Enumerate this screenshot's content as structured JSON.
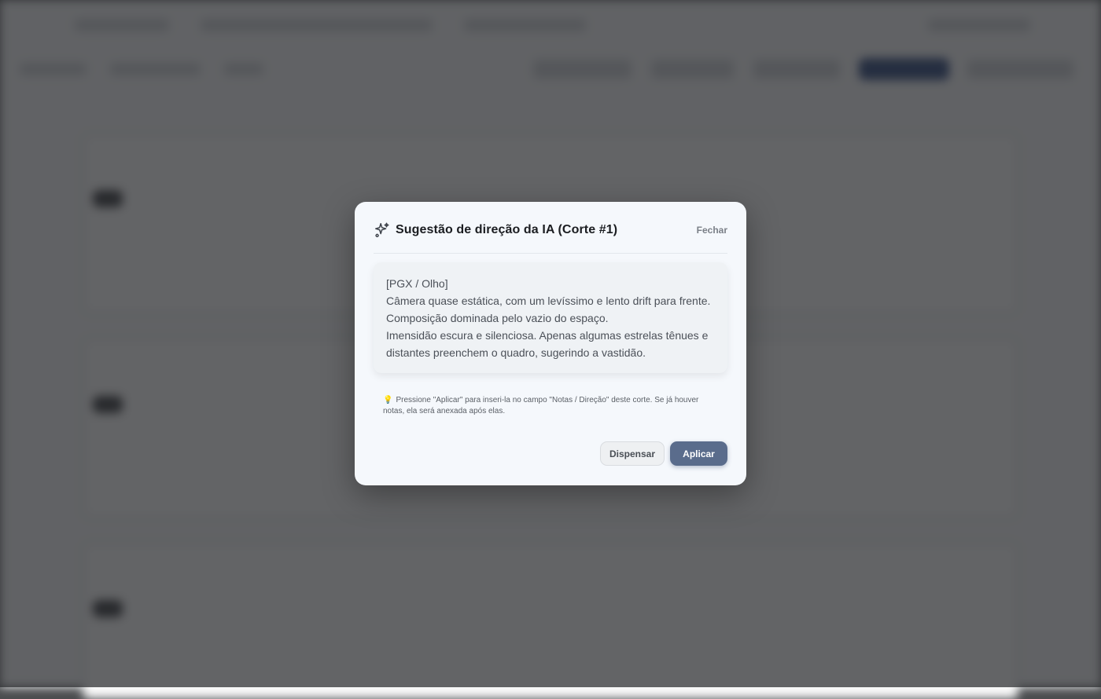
{
  "modal": {
    "title": "Sugestão de direção da IA (Corte #1)",
    "title_icon": "sparkle-icon",
    "close_label": "Fechar",
    "suggestion_lines": [
      "[PGX / Olho]",
      "Câmera quase estática, com um levíssimo e lento drift para frente.",
      "Composição dominada pelo vazio do espaço.",
      "Imensidão escura e silenciosa. Apenas algumas estrelas tênues e distantes preenchem o quadro, sugerindo a vastidão."
    ],
    "hint_icon": "lightbulb-icon",
    "hint_text": "Pressione \"Aplicar\" para inseri-la no campo \"Notas / Direção\" deste corte. Se já houver notas, ela será anexada após elas.",
    "dismiss_label": "Dispensar",
    "apply_label": "Aplicar"
  },
  "colors": {
    "apply_button": "#5a6c8c",
    "modal_background": "#f5f8fc",
    "overlay": "#4b4d4f"
  }
}
